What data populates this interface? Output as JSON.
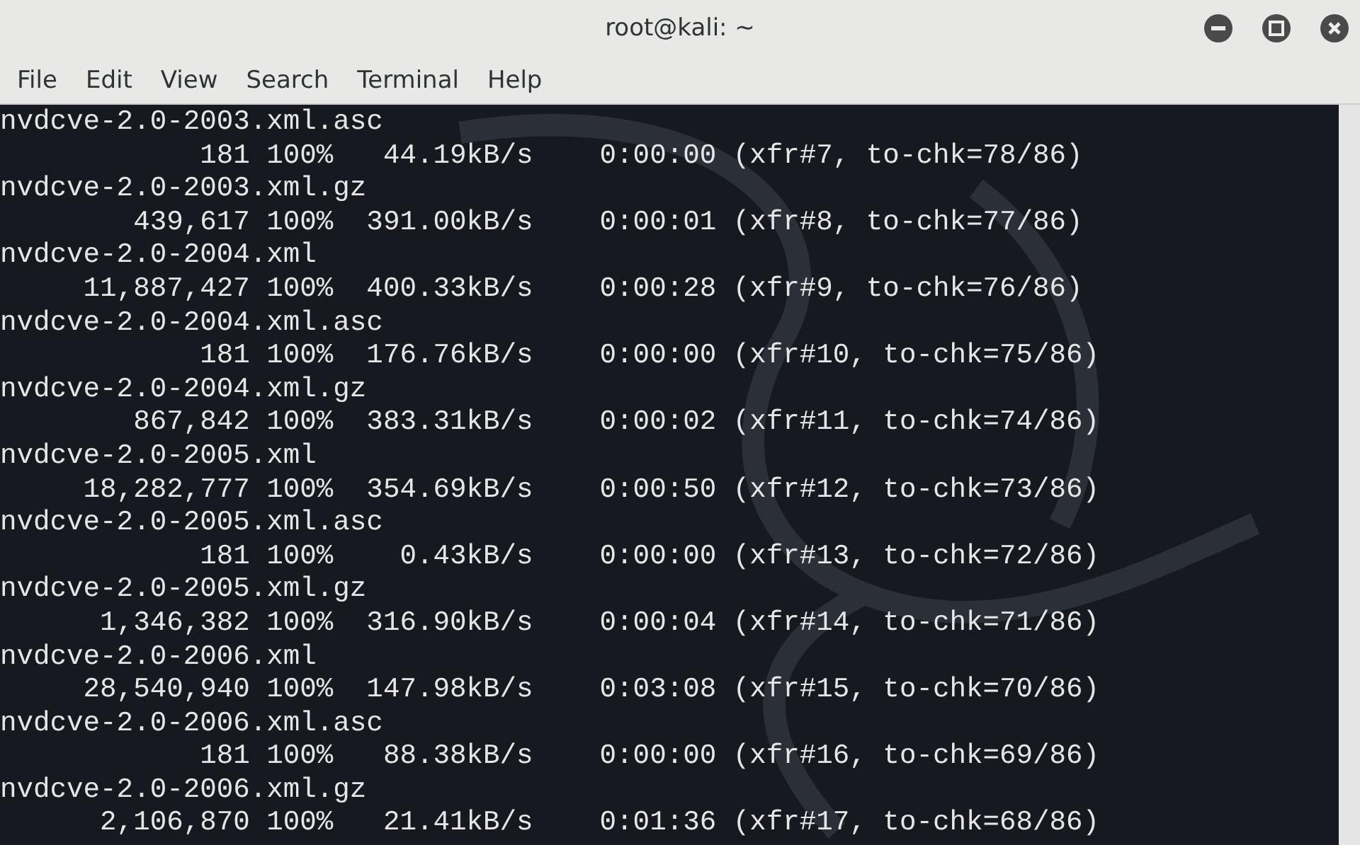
{
  "window": {
    "title": "root@kali: ~"
  },
  "menu": [
    "File",
    "Edit",
    "View",
    "Search",
    "Terminal",
    "Help"
  ],
  "terminal": {
    "lines": [
      "nvdcve-2.0-2003.xml.asc",
      "            181 100%   44.19kB/s    0:00:00 (xfr#7, to-chk=78/86)",
      "nvdcve-2.0-2003.xml.gz",
      "        439,617 100%  391.00kB/s    0:00:01 (xfr#8, to-chk=77/86)",
      "nvdcve-2.0-2004.xml",
      "     11,887,427 100%  400.33kB/s    0:00:28 (xfr#9, to-chk=76/86)",
      "nvdcve-2.0-2004.xml.asc",
      "            181 100%  176.76kB/s    0:00:00 (xfr#10, to-chk=75/86)",
      "nvdcve-2.0-2004.xml.gz",
      "        867,842 100%  383.31kB/s    0:00:02 (xfr#11, to-chk=74/86)",
      "nvdcve-2.0-2005.xml",
      "     18,282,777 100%  354.69kB/s    0:00:50 (xfr#12, to-chk=73/86)",
      "nvdcve-2.0-2005.xml.asc",
      "            181 100%    0.43kB/s    0:00:00 (xfr#13, to-chk=72/86)",
      "nvdcve-2.0-2005.xml.gz",
      "      1,346,382 100%  316.90kB/s    0:00:04 (xfr#14, to-chk=71/86)",
      "nvdcve-2.0-2006.xml",
      "     28,540,940 100%  147.98kB/s    0:03:08 (xfr#15, to-chk=70/86)",
      "nvdcve-2.0-2006.xml.asc",
      "            181 100%   88.38kB/s    0:00:00 (xfr#16, to-chk=69/86)",
      "nvdcve-2.0-2006.xml.gz",
      "      2,106,870 100%   21.41kB/s    0:01:36 (xfr#17, to-chk=68/86)"
    ]
  }
}
